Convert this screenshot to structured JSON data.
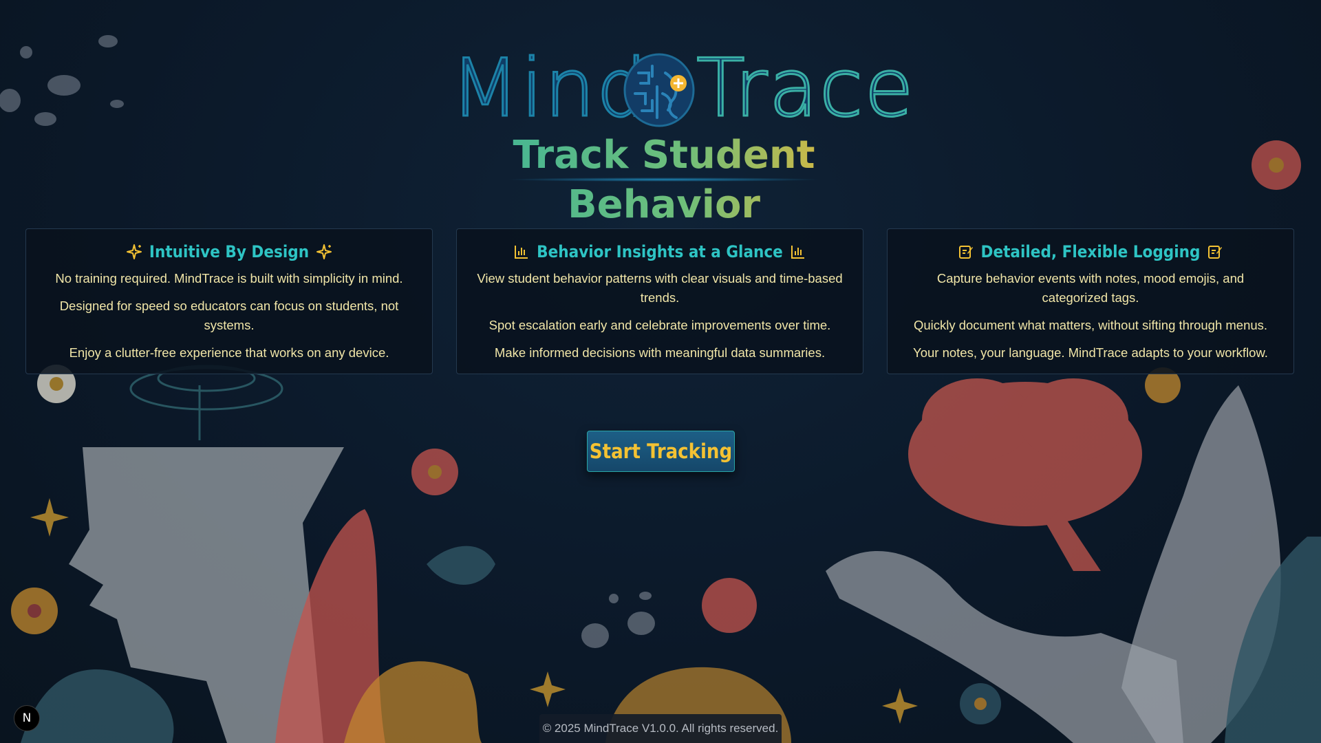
{
  "logo": {
    "word_left": "Mind",
    "word_right": "Trace",
    "subtitle": "Track Student Behavior"
  },
  "features": [
    {
      "title": "Intuitive By Design",
      "icon_left": "sparkle-icon",
      "icon_right": "sparkle-icon",
      "lines": [
        "No training required. MindTrace is built with simplicity in mind.",
        "Designed for speed so educators can focus on students, not systems.",
        "Enjoy a clutter-free experience that works on any device."
      ]
    },
    {
      "title": "Behavior Insights at a Glance",
      "icon_left": "bar-chart-icon",
      "icon_right": "bar-chart-icon",
      "lines": [
        "View student behavior patterns with clear visuals and time-based trends.",
        "Spot escalation early and celebrate improvements over time.",
        "Make informed decisions with meaningful data summaries."
      ]
    },
    {
      "title": "Detailed, Flexible Logging",
      "icon_left": "edit-note-icon",
      "icon_right": "edit-note-icon",
      "lines": [
        "Capture behavior events with notes, mood emojis, and categorized tags.",
        "Quickly document what matters, without sifting through menus.",
        "Your notes, your language. MindTrace adapts to your workflow."
      ]
    }
  ],
  "cta": {
    "label": "Start Tracking"
  },
  "footer": {
    "text": "© 2025 MindTrace V1.0.0. All rights reserved."
  },
  "dev_badge": {
    "label": "N"
  },
  "colors": {
    "background": "#0b1828",
    "accent_teal": "#2ec4c4",
    "accent_gold": "#f4c233",
    "card_text": "#f1e6a8"
  }
}
